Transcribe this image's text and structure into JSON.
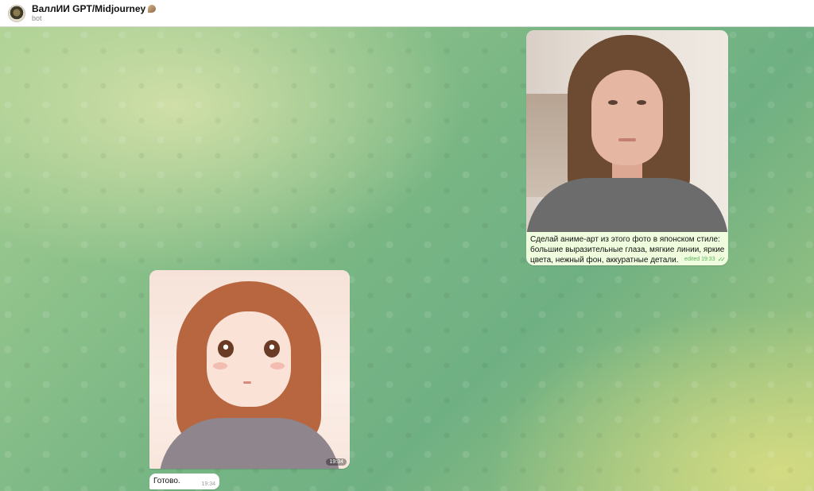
{
  "header": {
    "title": "ВаллИИ GPT/Midjourney",
    "subtitle": "bot",
    "avatar_icon": "bot-avatar",
    "title_icon": "shell-icon"
  },
  "messages": {
    "outgoing": {
      "image_icon": "user-photo-image",
      "text": "Сделай аниме-арт из этого фото в японском стиле: большие выразительные глаза, мягкие линии, яркие цвета, нежный фон, аккуратные детали.",
      "meta": "edited 19:33",
      "status_icon": "double-check-icon"
    },
    "incoming_image": {
      "image_icon": "anime-art-image",
      "time": "19:34"
    },
    "incoming_text": {
      "text": "Готово.",
      "time": "19:34"
    }
  },
  "colors": {
    "outgoing_bubble": "#effdde",
    "incoming_bubble": "#ffffff",
    "check_color": "#5fae5a"
  }
}
